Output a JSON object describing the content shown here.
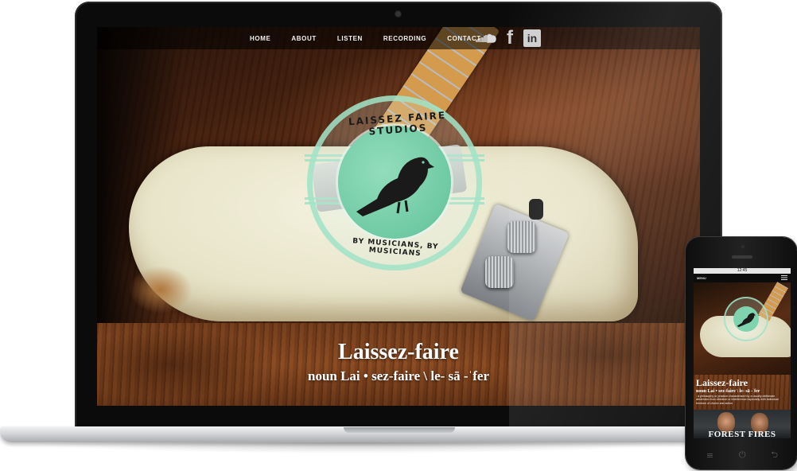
{
  "nav": {
    "items": [
      "HOME",
      "ABOUT",
      "LISTEN",
      "RECORDING",
      "CONTACT"
    ],
    "social_icons": [
      "soundcloud-icon",
      "facebook-icon",
      "linkedin-icon"
    ],
    "facebook_glyph": "f",
    "linkedin_glyph": "in"
  },
  "logo": {
    "top_text": "LAISSEZ FAIRE STUDIOS",
    "bottom_text": "BY MUSICIANS, BY MUSICIANS",
    "color": "#7fd3ae"
  },
  "hero": {
    "title": "Laissez-faire",
    "subtitle": "noun Lai • sez-faire \\ le- sā -ˈfer"
  },
  "mobile": {
    "status_time": "12:45",
    "menu_label": "MENU",
    "title": "Laissez-faire",
    "subtitle": "noun Lai • sez-faire \\ le- sā -ˈfer",
    "description": ": a philosophy or practice characterized by a usually deliberate abstention from direction or interference especially with individual freedom of choice and action",
    "section_title": "FOREST FIRES",
    "buttons": [
      "≡",
      "⏻",
      "⮌"
    ]
  }
}
